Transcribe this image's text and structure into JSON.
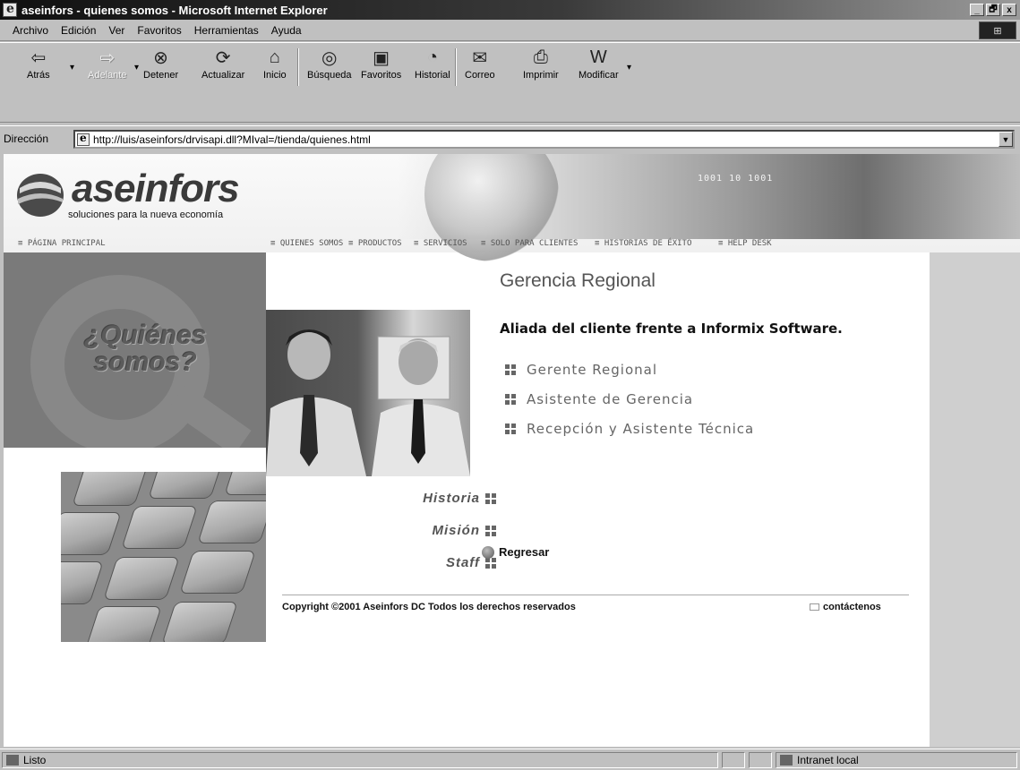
{
  "window": {
    "title": "aseinfors - quienes somos - Microsoft Internet Explorer",
    "controls": [
      "_",
      "🗗",
      "x"
    ]
  },
  "menu": [
    {
      "label": "Archivo"
    },
    {
      "label": "Edición"
    },
    {
      "label": "Ver"
    },
    {
      "label": "Favoritos"
    },
    {
      "label": "Herramientas"
    },
    {
      "label": "Ayuda"
    }
  ],
  "toolbar": {
    "back": "Atrás",
    "forward": "Adelante",
    "stop": "Detener",
    "refresh": "Actualizar",
    "home": "Inicio",
    "search": "Búsqueda",
    "favorites": "Favoritos",
    "history": "Historial",
    "mail": "Correo",
    "print": "Imprimir",
    "edit": "Modificar"
  },
  "address": {
    "label": "Dirección",
    "url": "http://luis/aseinfors/drvisapi.dll?MIval=/tienda/quienes.html"
  },
  "site": {
    "brand": "aseinfors",
    "tagline": "soluciones para la nueva economía",
    "banner_code": "1001 10 1001 ",
    "nav": [
      "≡ PÁGINA PRINCIPAL",
      "≡ QUIENES SOMOS",
      "≡ PRODUCTOS",
      "≡ SERVICIOS",
      "≡ SOLO PARA CLIENTES",
      "≡ HISTORIAS DE ÉXITO",
      "≡ HELP DESK"
    ],
    "quienes": [
      "¿Quiénes",
      "somos?"
    ],
    "heading": "Gerencia Regional",
    "subheading": "Aliada del cliente frente a Informix Software.",
    "links": [
      "Gerente Regional",
      "Asistente de Gerencia",
      "Recepción y Asistente Técnica"
    ],
    "side_links": [
      "Historia",
      "Misión",
      "Staff"
    ],
    "back_link": "Regresar",
    "copyright": "Copyright ©2001 Aseinfors DC",
    "rights": "Todos los derechos reservados",
    "contact": "contáctenos"
  },
  "status": {
    "text": "Listo",
    "zone": "Intranet local"
  }
}
